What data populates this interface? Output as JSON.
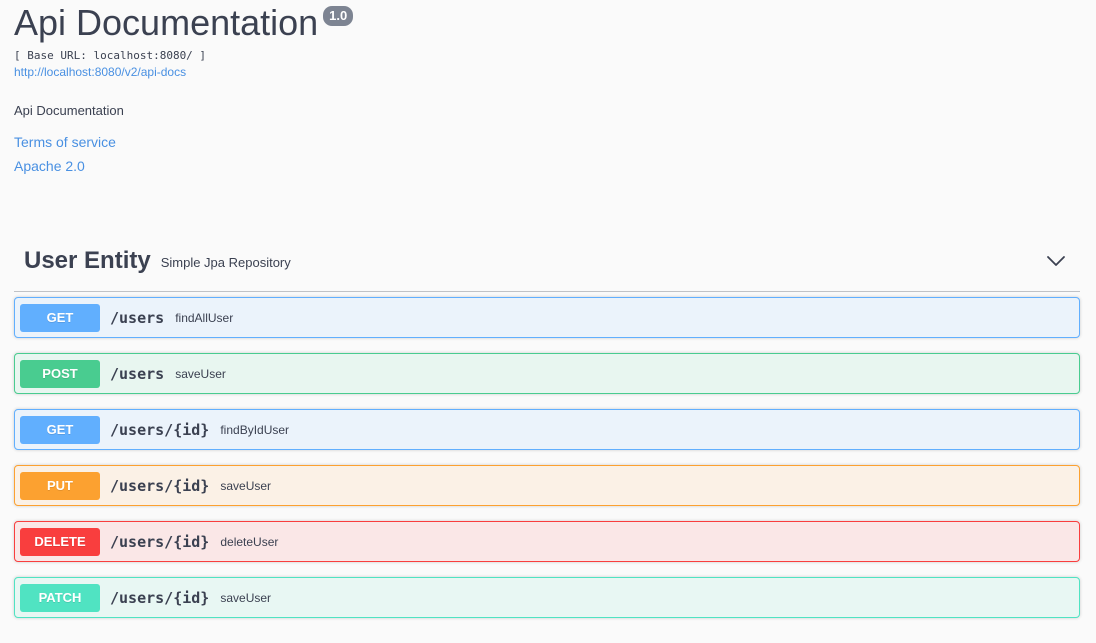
{
  "info": {
    "title": "Api Documentation",
    "version": "1.0",
    "base_url": "[ Base URL: localhost:8080/ ]",
    "docs_link": "http://localhost:8080/v2/api-docs",
    "description": "Api Documentation",
    "terms_of_service": "Terms of service",
    "license": "Apache 2.0"
  },
  "tag": {
    "name": "User Entity",
    "description": "Simple Jpa Repository",
    "expand_icon": "chevron-down-icon"
  },
  "operations": [
    {
      "method": "GET",
      "path": "/users",
      "summary": "findAllUser"
    },
    {
      "method": "POST",
      "path": "/users",
      "summary": "saveUser"
    },
    {
      "method": "GET",
      "path": "/users/{id}",
      "summary": "findByIdUser"
    },
    {
      "method": "PUT",
      "path": "/users/{id}",
      "summary": "saveUser"
    },
    {
      "method": "DELETE",
      "path": "/users/{id}",
      "summary": "deleteUser"
    },
    {
      "method": "PATCH",
      "path": "/users/{id}",
      "summary": "saveUser"
    }
  ],
  "colors": {
    "GET": {
      "badge": "#61affe",
      "bg": "#ebf3fb",
      "border": "#61affe"
    },
    "POST": {
      "badge": "#49cc90",
      "bg": "#e8f6f0",
      "border": "#49cc90"
    },
    "PUT": {
      "badge": "#fca130",
      "bg": "#fbf1e6",
      "border": "#fca130"
    },
    "DELETE": {
      "badge": "#f93e3e",
      "bg": "#fae7e7",
      "border": "#f93e3e"
    },
    "PATCH": {
      "badge": "#50e3c2",
      "bg": "#e8f7f3",
      "border": "#50e3c2"
    }
  }
}
